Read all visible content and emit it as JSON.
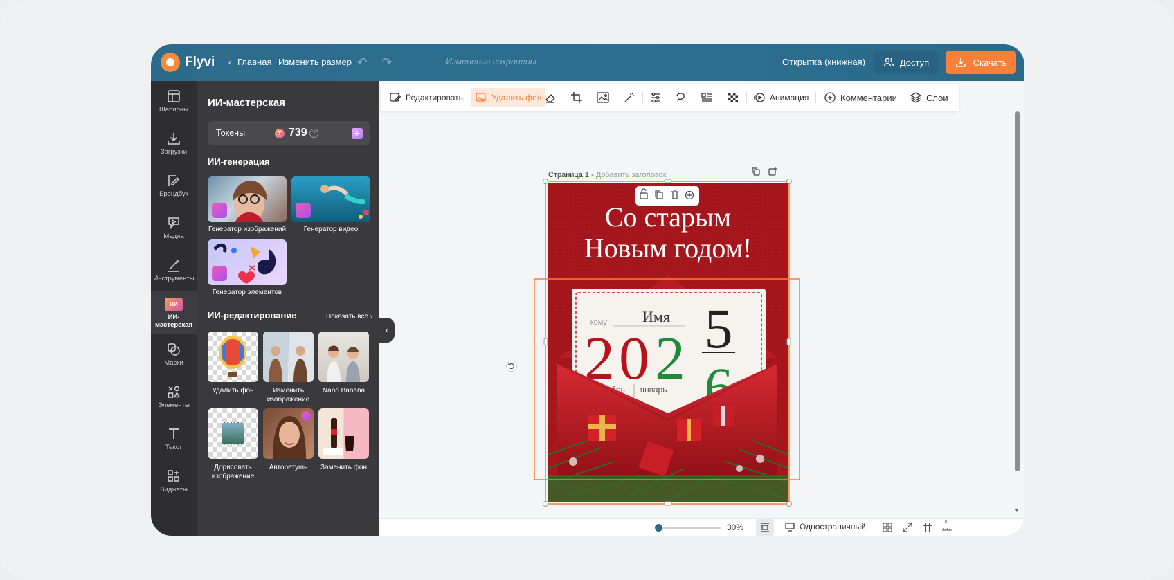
{
  "topbar": {
    "brand": "Flyvi",
    "home_label": "Главная",
    "resize_label": "Изменить размер",
    "saved_status": "Изменения сохранены",
    "doc_type": "Открытка (книжная)",
    "access_label": "Доступ",
    "download_label": "Скачать"
  },
  "rail": {
    "items": [
      {
        "label": "Шаблоны",
        "icon": "templates-icon"
      },
      {
        "label": "Загрузки",
        "icon": "upload-icon"
      },
      {
        "label": "Брендбук",
        "icon": "brandbook-icon"
      },
      {
        "label": "Медиа",
        "icon": "media-icon"
      },
      {
        "label": "Инструменты",
        "icon": "tools-icon"
      },
      {
        "label": "ИИ-мастерская",
        "icon": "ai-workshop-icon",
        "active": true
      },
      {
        "label": "Маски",
        "icon": "masks-icon"
      },
      {
        "label": "Элементы",
        "icon": "elements-icon"
      },
      {
        "label": "Текст",
        "icon": "text-icon"
      },
      {
        "label": "Виджеты",
        "icon": "widgets-icon"
      }
    ],
    "ai_badge": "ИИ"
  },
  "panel": {
    "title": "ИИ-мастерская",
    "tokens_label": "Токены",
    "tokens_coin": "Т",
    "tokens_value": "739",
    "tokens_help": "?",
    "tokens_add": "+",
    "gen_heading": "ИИ-генерация",
    "gen_tiles": [
      {
        "caption": "Генератор изображений"
      },
      {
        "caption": "Генератор видео"
      },
      {
        "caption": "Генератор элементов"
      }
    ],
    "edit_heading": "ИИ-редактирование",
    "show_all": "Показать все",
    "edit_tiles": [
      {
        "caption": "Удалить фон"
      },
      {
        "caption": "Изменить изображение"
      },
      {
        "caption": "Nano Banana"
      },
      {
        "caption": "Дорисовать изображение"
      },
      {
        "caption": "Авторетушь"
      },
      {
        "caption": "Заменить фон"
      }
    ]
  },
  "toolbar": {
    "edit_label": "Редактировать",
    "remove_bg_label": "Удалить фон",
    "animation_label": "Анимация",
    "comments_label": "Комментарии",
    "layers_label": "Слои"
  },
  "page": {
    "label": "Страница 1 -",
    "add_title": "Добавить заголовок"
  },
  "card": {
    "title_line1": "Со старым",
    "title_line2": "Новым годом!",
    "to_label": "кому:",
    "name": "Имя",
    "year_digits": [
      "2",
      "0",
      "2"
    ],
    "year_green_digit": "2",
    "numerator": "5",
    "denominator": "6",
    "month_left": "декабрь",
    "month_right": "январь",
    "colors": {
      "red": "#b8121b",
      "green": "#1f8a3c",
      "bg": "#a5161d"
    }
  },
  "bottombar": {
    "zoom": "30%",
    "zoom_fraction": 0.0,
    "view_mode": "Одностраничный",
    "page_counter": "0"
  },
  "colors": {
    "accent": "#fb7f38",
    "topbar": "#2d6b8c",
    "rail": "#2e2e31",
    "panel": "#3a3a3d"
  }
}
